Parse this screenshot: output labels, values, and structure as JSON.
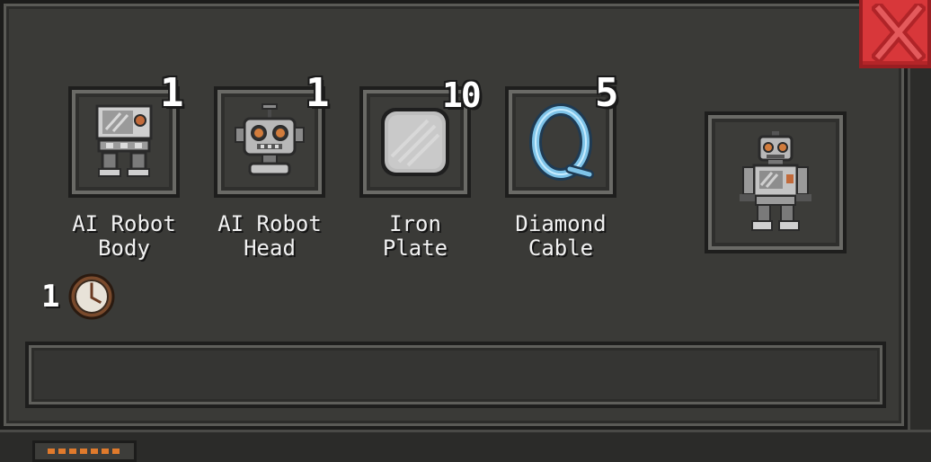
{
  "window": {
    "close_icon": "close-x-icon",
    "accent_color": "#d8373a"
  },
  "recipe": {
    "ingredients": [
      {
        "label": "AI Robot\nBody",
        "quantity": "1",
        "icon": "robot-body-icon"
      },
      {
        "label": "AI Robot\nHead",
        "quantity": "1",
        "icon": "robot-head-icon"
      },
      {
        "label": "Iron\nPlate",
        "quantity": "10",
        "icon": "iron-plate-icon"
      },
      {
        "label": "Diamond\nCable",
        "quantity": "5",
        "icon": "diamond-cable-icon"
      }
    ],
    "result": {
      "icon": "ai-robot-icon"
    },
    "craft_time": {
      "value": "1",
      "icon": "clock-icon"
    }
  },
  "info_bar": {
    "text": ""
  }
}
